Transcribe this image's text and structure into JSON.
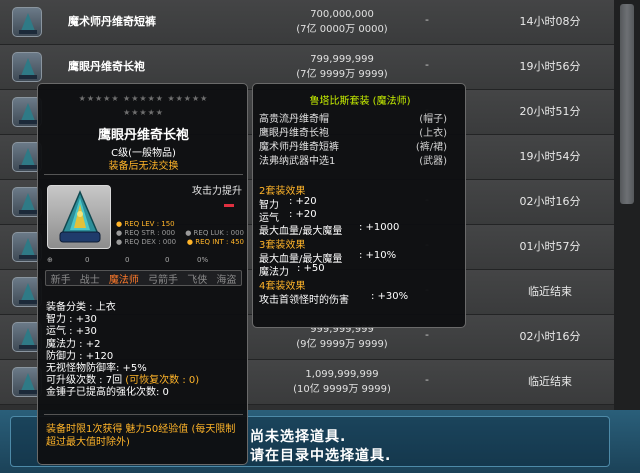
{
  "market": {
    "rows": [
      {
        "name": "魔术师丹维奇短裤",
        "price_line1": "700,000,000",
        "price_line2": "(7亿 0000万 0000)",
        "dash": "-",
        "time": "14小时08分"
      },
      {
        "name": "鹰眼丹维奇长袍",
        "price_line1": "799,999,999",
        "price_line2": "(7亿 9999万 9999)",
        "dash": "-",
        "time": "19小时56分"
      },
      {
        "name": "",
        "price_line1": "",
        "price_line2": "",
        "dash": "-",
        "time": "20小时51分"
      },
      {
        "name": "",
        "price_line1": "",
        "price_line2": "",
        "dash": "-",
        "time": "19小时54分"
      },
      {
        "name": "",
        "price_line1": "",
        "price_line2": "",
        "dash": "-",
        "time": "02小时16分"
      },
      {
        "name": "",
        "price_line1": "",
        "price_line2": "",
        "dash": "-",
        "time": "01小时57分"
      },
      {
        "name": "",
        "price_line1": "",
        "price_line2": "",
        "dash": "-",
        "time": "临近结束"
      },
      {
        "name": "",
        "price_line1": "999,999,999",
        "price_line2": "(9亿 9999万 9999)",
        "dash": "-",
        "time": "02小时16分"
      },
      {
        "name": "",
        "price_line1": "1,099,999,999",
        "price_line2": "(10亿 9999万 9999)",
        "dash": "-",
        "time": "临近结束"
      }
    ]
  },
  "bottom": {
    "line1": "尚未选择道具.",
    "line2": "请在目录中选择道具."
  },
  "tooltip": {
    "stars1": "★★★★★ ★★★★★ ★★★★★",
    "stars2": "★★★★★",
    "name": "鹰眼丹维奇长袍",
    "grade": "C级(一般物品)",
    "trade": "装备后无法交换",
    "atk_label": "攻击力提升",
    "reqs": [
      {
        "left": "● REQ LEV : 150",
        "right": ""
      },
      {
        "left": "● REQ STR : 000",
        "right": "● REQ LUK : 000"
      },
      {
        "left": "● REQ DEX : 000",
        "right": "● REQ INT : 450"
      }
    ],
    "small_icons": [
      "⊕",
      "0",
      "0",
      "0",
      "0%"
    ],
    "jobs": [
      "新手",
      "战士",
      "魔法师",
      "弓箭手",
      "飞侠",
      "海盗"
    ],
    "active_job": "魔法师",
    "stats": [
      "装备分类 : 上衣",
      "智力 : +30",
      "运气 : +30",
      "魔法力 : +2",
      "防御力 : +120",
      "无视怪物防御率: +5%",
      "可升级次数 : 7回",
      "金锤子已提高的强化次数: 0"
    ],
    "restore_label": "(可恢复次数 : 0)",
    "limit1": "装备时限1次获得 魅力50经验值 (每天限制",
    "limit2": "超过最大值时除外)"
  },
  "settip": {
    "title": "鲁塔比斯套装 (魔法师)",
    "items": [
      {
        "name": "高贵流丹维奇帽",
        "slot": "(帽子)"
      },
      {
        "name": "鹰眼丹维奇长袍",
        "slot": "(上衣)"
      },
      {
        "name": "魔术师丹维奇短裤",
        "slot": "(裤/裙)"
      },
      {
        "name": "法弗纳武器中选1",
        "slot": "(武器)"
      }
    ],
    "effects": [
      {
        "title": "2套装效果",
        "stats": [
          {
            "k": "智力",
            "v": ": +20"
          },
          {
            "k": "运气",
            "v": ": +20"
          },
          {
            "k": "最大血量/最大魔量",
            "v": ": +1000"
          }
        ]
      },
      {
        "title": "3套装效果",
        "stats": [
          {
            "k": "最大血量/最大魔量",
            "v": ": +10%"
          },
          {
            "k": "魔法力",
            "v": ": +50"
          }
        ]
      },
      {
        "title": "4套装效果",
        "stats": [
          {
            "k": "攻击首领怪时的伤害",
            "v": ": +30%"
          }
        ]
      }
    ]
  }
}
